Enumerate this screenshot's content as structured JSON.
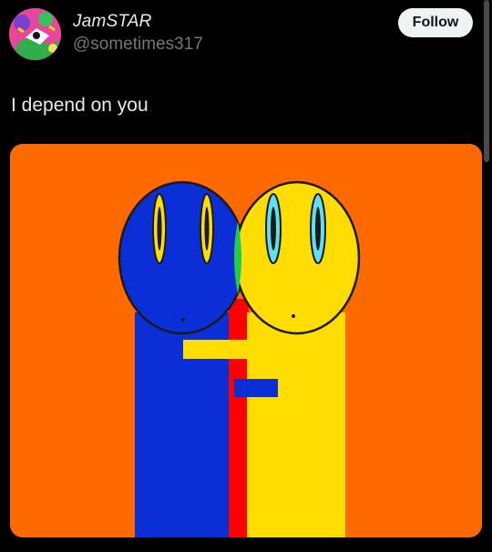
{
  "author": {
    "display_name": "JamSTAR",
    "handle": "@sometimes317"
  },
  "actions": {
    "follow_label": "Follow"
  },
  "post": {
    "text": "I depend on you"
  },
  "icons": {
    "avatar": "cartoon-avatar",
    "media": "two-smiley-figures-hugging"
  },
  "colors": {
    "background": "#000000",
    "primary_text": "#e7e9ea",
    "secondary_text": "#71767b",
    "follow_button_bg": "#eff3f4",
    "follow_button_text": "#0f1419",
    "image_orange": "#ff6a00",
    "image_blue": "#0a2fd6",
    "image_yellow": "#ffdd00",
    "image_red": "#ff0000"
  }
}
